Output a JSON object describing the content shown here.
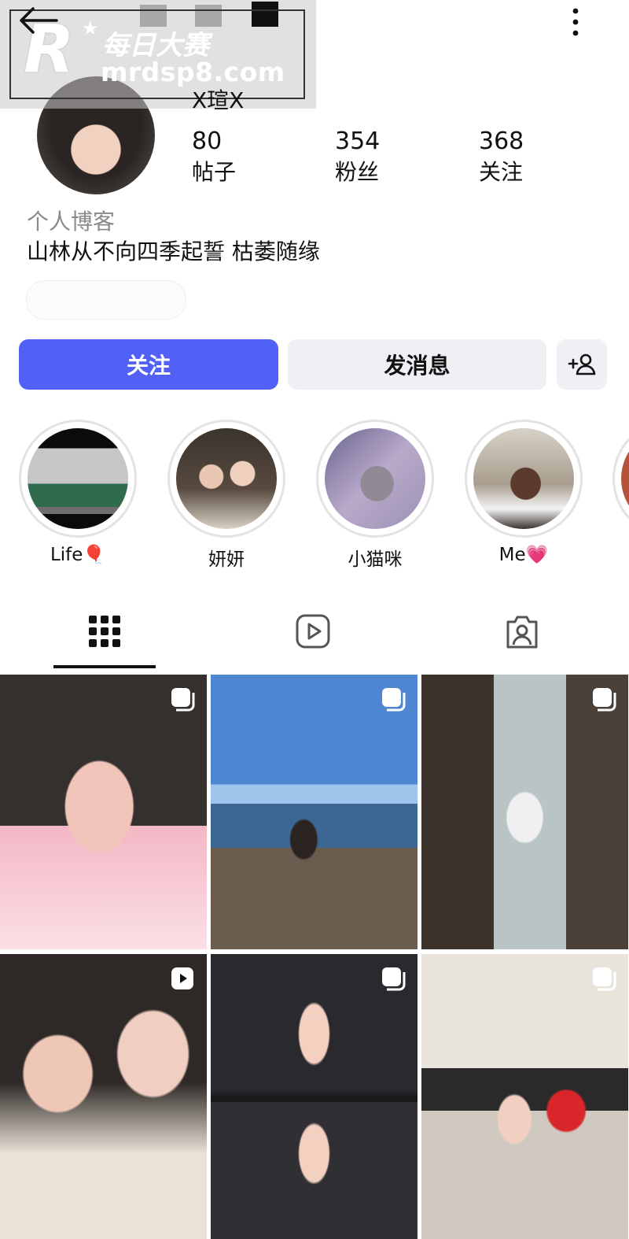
{
  "watermark": {
    "logo_letter": "R",
    "brand": "每日大赛",
    "url": "mrdsp8.com"
  },
  "profile": {
    "username": "X瑄X",
    "stats": [
      {
        "value": "80",
        "label": "帖子"
      },
      {
        "value": "354",
        "label": "粉丝"
      },
      {
        "value": "368",
        "label": "关注"
      }
    ],
    "category": "个人博客",
    "bio": "山林从不向四季起誓 枯萎随缘"
  },
  "actions": {
    "follow_label": "关注",
    "message_label": "发消息",
    "add_icon": "add-person-icon"
  },
  "highlights": [
    {
      "label": "Life🎈"
    },
    {
      "label": "妍妍"
    },
    {
      "label": "小猫咪"
    },
    {
      "label": "Me💗"
    }
  ],
  "tabs": [
    {
      "icon": "grid-icon",
      "active": true
    },
    {
      "icon": "reels-icon",
      "active": false
    },
    {
      "icon": "tagged-icon",
      "active": false
    }
  ],
  "colors": {
    "accent": "#5161f6",
    "button_gray": "#efeff4"
  }
}
